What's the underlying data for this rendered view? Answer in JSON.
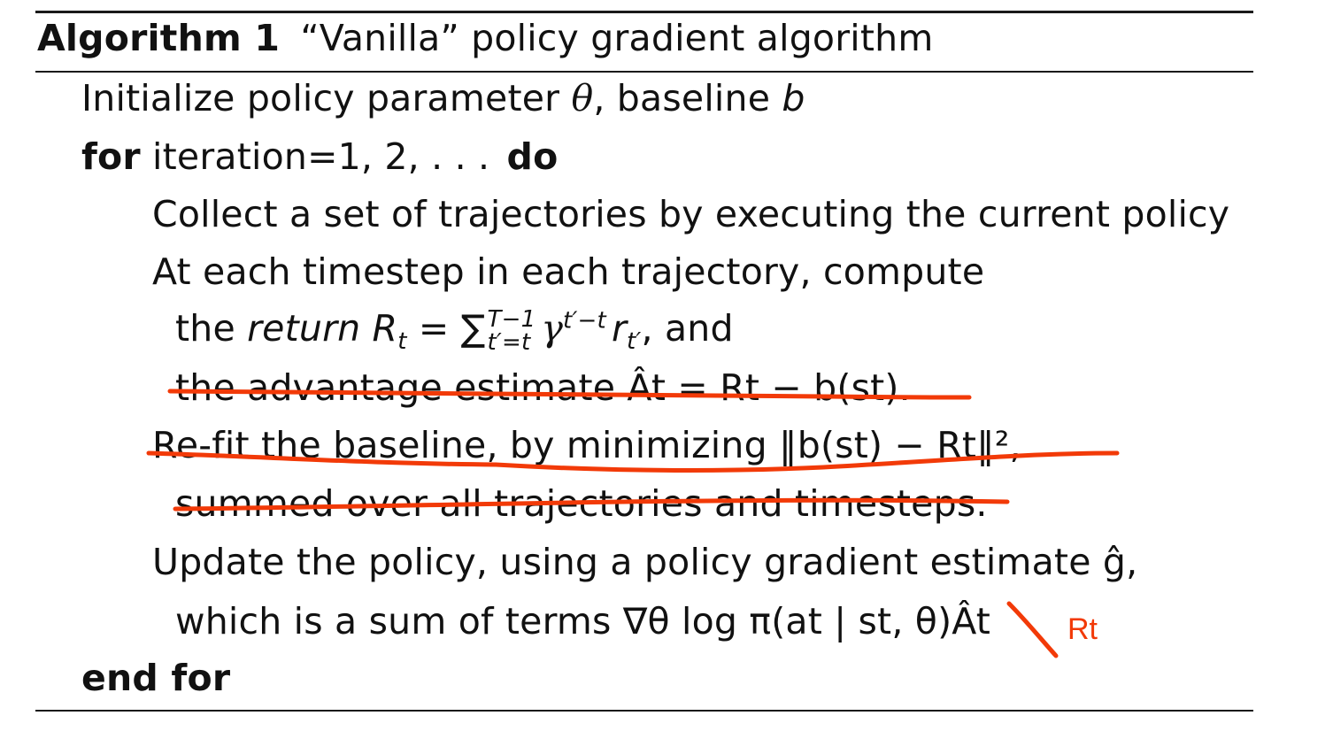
{
  "algorithm": {
    "label": "Algorithm 1",
    "title": "“Vanilla” policy gradient algorithm",
    "init": {
      "text": "Initialize policy parameter ",
      "theta": "θ",
      "mid": ", baseline ",
      "b": "b"
    },
    "for": {
      "kw": "for",
      "rest": " iteration=1, 2, . . . ",
      "do": "do"
    },
    "collect": "Collect a set of trajectories by executing the current policy",
    "at_each": "At each timestep in each trajectory, compute",
    "return_line": {
      "the": "the ",
      "return": "return",
      "R": "R",
      "t": "t",
      "eq": " = ∑",
      "upper": "T−1",
      "lower": "t′=t",
      "gamma": "γ",
      "exp": "t′−t",
      "r": "r",
      "rsub": "t′",
      "tail": ", and"
    },
    "advantage_line": "the advantage estimate Ât = Rt − b(st).",
    "refit_line": "Re-fit the baseline, by minimizing ‖b(st) − Rt‖², ",
    "summed_line": "summed over all trajectories and timesteps.",
    "update_line": "Update the policy, using a policy gradient estimate ĝ,",
    "which_line": "which is a sum of terms ∇θ log π(at | st, θ)Ât",
    "end": "end for"
  },
  "annotation": {
    "note": "Rt",
    "ink_color": "#f23a08"
  }
}
